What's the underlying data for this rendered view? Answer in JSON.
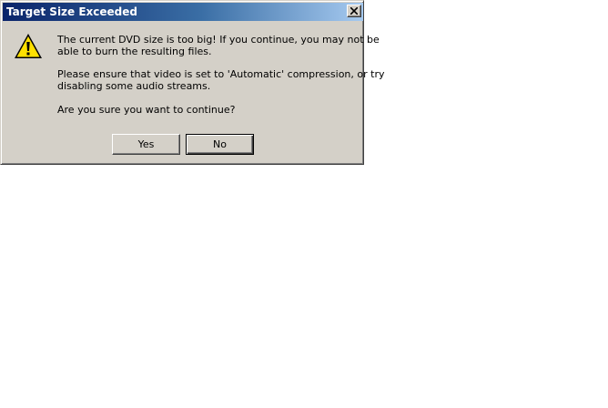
{
  "window": {
    "title": "Target Size Exceeded"
  },
  "message": {
    "line1": "The current DVD size is too big! If you continue, you may not be",
    "line2": "able to burn the resulting files.",
    "line3": "Please ensure that video is set to 'Automatic' compression, or try",
    "line4": "disabling some audio streams.",
    "line5": "Are you sure you want to continue?"
  },
  "buttons": {
    "yes": "Yes",
    "no": "No"
  },
  "icons": {
    "warning": "warning-icon",
    "close": "close-icon"
  },
  "colors": {
    "title_bar_start": "#0a246a",
    "title_bar_end": "#a6caf0",
    "dialog_face": "#d4d0c8",
    "warning_yellow": "#ffe000"
  }
}
